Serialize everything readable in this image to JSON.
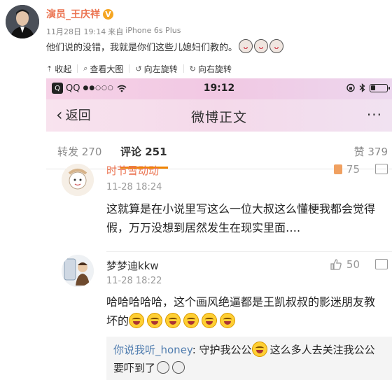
{
  "post": {
    "author": "演员_王庆祥",
    "verified_badge": "V",
    "date": "11月28日 19:14",
    "source_prefix": "来自",
    "source": "iPhone 6s Plus",
    "text": "他们说的没错，我就是你们这些儿媳妇们教的。",
    "emoji_count": 3
  },
  "image_toolbar": {
    "items": [
      {
        "icon": "collapse-icon",
        "label": "收起"
      },
      {
        "icon": "zoom-icon",
        "label": "查看大图"
      },
      {
        "icon": "rotate-left-icon",
        "label": "向左旋转"
      },
      {
        "icon": "rotate-right-icon",
        "label": "向右旋转"
      }
    ]
  },
  "screenshot": {
    "status_bar": {
      "carrier": "QQ",
      "signal": "●●○○○",
      "time": "19:12",
      "battery_level": 0.25
    },
    "nav": {
      "back_label": "返回",
      "title": "微博正文",
      "more": "···"
    },
    "tabs": {
      "repost": "转发 270",
      "comment": "评论 251",
      "like": "赞 379"
    },
    "comments": [
      {
        "user": "时节雪动动",
        "time": "11-28 18:24",
        "likes": "75",
        "text": "这就算是在小说里写这么一位大叔这么懂梗我都会觉得假，万万没想到居然发生在现实里面…."
      },
      {
        "user": "梦梦迪kkw",
        "time": "11-28 18:22",
        "likes": "50",
        "text": "哈哈哈哈哈，这个画风绝逼都是王凯叔叔的影迷朋友教坏的",
        "laugh_count": 6,
        "reply": {
          "user": "你说我听_honey",
          "text": "守护我公公",
          "text2": "这么多人去关注我公公要吓到了"
        }
      }
    ]
  },
  "colors": {
    "accent_orange": "#eb7350",
    "tab_underline": "#f08300",
    "reply_user_blue": "#507daf",
    "status_pink": "#f1c8e3"
  }
}
